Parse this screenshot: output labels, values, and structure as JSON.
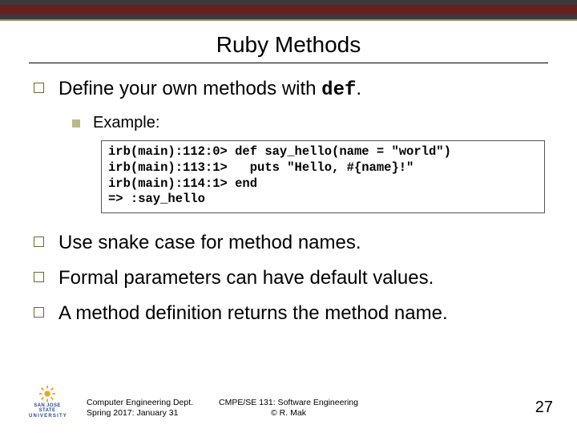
{
  "title": "Ruby Methods",
  "bullets": {
    "b1_pre": "Define your own methods with ",
    "b1_code": "def",
    "b1_post": ".",
    "b2": "Example:",
    "b3": "Use snake case for method names.",
    "b4": "Formal parameters can have default values.",
    "b5": "A method definition returns the method name."
  },
  "code": "irb(main):112:0> def say_hello(name = \"world\")\nirb(main):113:1>   puts \"Hello, #{name}!\"\nirb(main):114:1> end\n=> :say_hello",
  "footer": {
    "logo_top": "SAN JOSE STATE",
    "logo_bot": "UNIVERSITY",
    "left1": "Computer Engineering Dept.",
    "left2": "Spring 2017: January 31",
    "center1": "CMPE/SE 131: Software Engineering",
    "center2": "© R. Mak",
    "page": "27"
  }
}
